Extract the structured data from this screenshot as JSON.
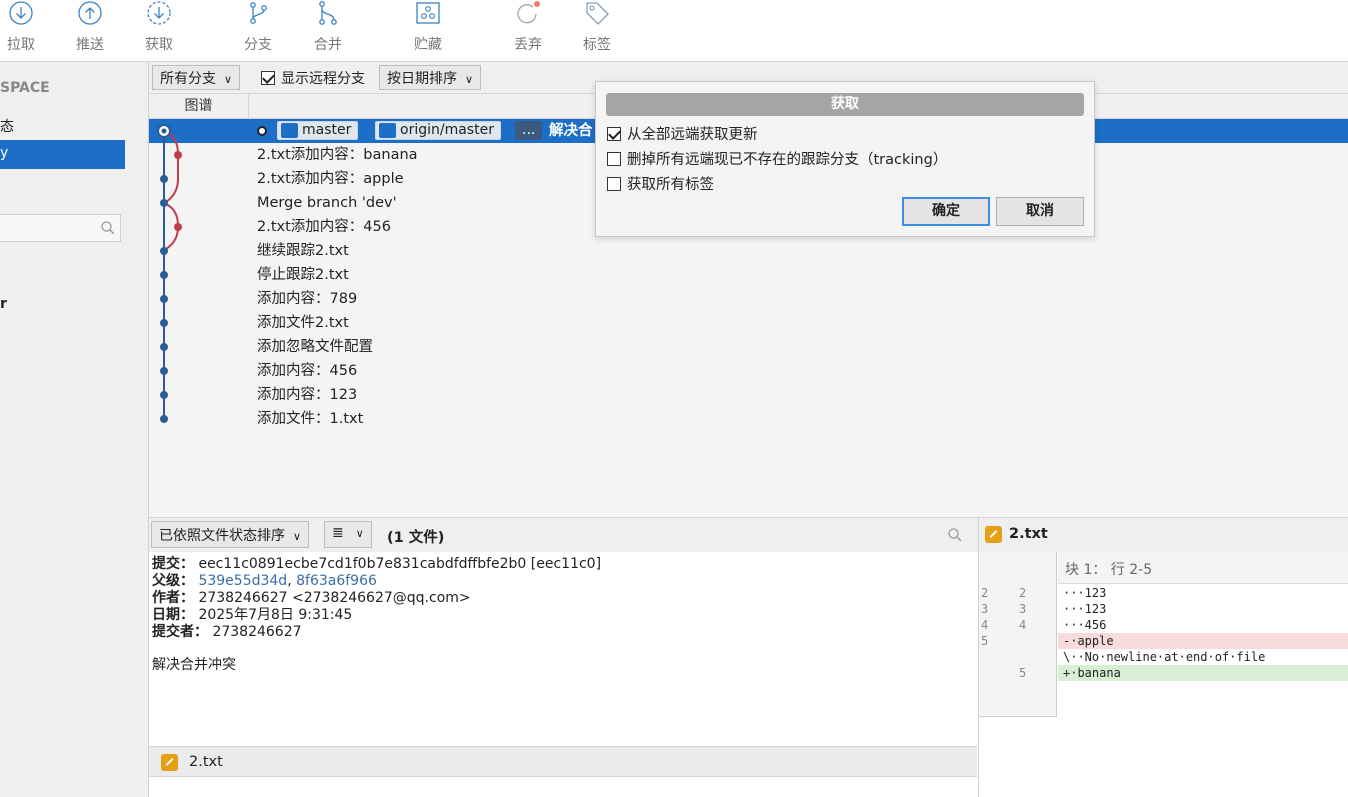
{
  "toolbar": {
    "pull": "拉取",
    "push": "推送",
    "fetch": "获取",
    "branch": "分支",
    "merge": "合并",
    "stash": "贮藏",
    "discard": "丢弃",
    "tag": "标签"
  },
  "sidebar": {
    "workspace": "SPACE",
    "item1": "态",
    "active": "y",
    "item_r": "r"
  },
  "filter": {
    "branches": "所有分支",
    "show_remote": "显示远程分支",
    "sort": "按日期排序"
  },
  "columns": {
    "graph": "图谱"
  },
  "commits": [
    {
      "message": "解决合",
      "tags": [
        "master",
        "origin/master",
        "..."
      ]
    },
    {
      "message": "2.txt添加内容：banana"
    },
    {
      "message": "2.txt添加内容：apple"
    },
    {
      "message": "Merge branch 'dev'"
    },
    {
      "message": "2.txt添加内容：456"
    },
    {
      "message": "继续跟踪2.txt"
    },
    {
      "message": "停止跟踪2.txt"
    },
    {
      "message": "添加内容：789"
    },
    {
      "message": "添加文件2.txt"
    },
    {
      "message": "添加忽略文件配置"
    },
    {
      "message": "添加内容：456"
    },
    {
      "message": "添加内容：123"
    },
    {
      "message": "添加文件：1.txt"
    }
  ],
  "files_bar": {
    "sort": "已依照文件状态排序",
    "view": "≣",
    "count": "(1 文件)"
  },
  "details": {
    "commit_label": "提交：",
    "commit_value": "eec11c0891ecbe7cd1f0b7e831cabdfdffbfe2b0 [eec11c0]",
    "parents_label": "父级：",
    "parent1": "539e55d34d",
    "parent_sep": ", ",
    "parent2": "8f63a6f966",
    "author_label": "作者：",
    "author_value": "2738246627 <2738246627@qq.com>",
    "date_label": "日期：",
    "date_value": "2025年7月8日 9:31:45",
    "committer_label": "提交者：",
    "committer_value": "2738246627",
    "message": "解决合并冲突"
  },
  "file_list": {
    "file": "2.txt"
  },
  "diff": {
    "file": "2.txt",
    "hunk": "块 1： 行 2-5",
    "lines": [
      {
        "old": "2",
        "new": "2",
        "text": "···123",
        "kind": "ctx"
      },
      {
        "old": "3",
        "new": "3",
        "text": "···123",
        "kind": "ctx"
      },
      {
        "old": "4",
        "new": "4",
        "text": "···456",
        "kind": "ctx"
      },
      {
        "old": "5",
        "new": "",
        "text": "-·apple",
        "kind": "del"
      },
      {
        "old": "",
        "new": "",
        "text": "\\··No·newline·at·end·of·file",
        "kind": "ctx"
      },
      {
        "old": "",
        "new": "5",
        "text": "+·banana",
        "kind": "add"
      }
    ]
  },
  "dialog": {
    "title": "获取",
    "opt1": "从全部远端获取更新",
    "opt1_checked": true,
    "opt2": "删掉所有远端现已不存在的跟踪分支（tracking）",
    "opt2_checked": false,
    "opt3": "获取所有标签",
    "opt3_checked": false,
    "ok": "确定",
    "cancel": "取消"
  }
}
